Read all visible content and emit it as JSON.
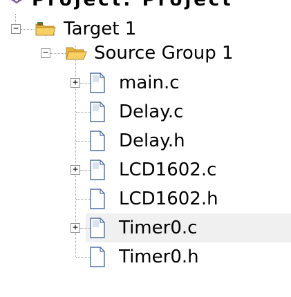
{
  "project": {
    "label": "Project: Project",
    "icon": "project-icon"
  },
  "target": {
    "label": "Target 1",
    "icon": "target-folder-icon",
    "toggle": "−"
  },
  "group": {
    "label": "Source Group 1",
    "icon": "folder-open-icon",
    "toggle": "−"
  },
  "files": [
    {
      "name": "main.c",
      "icon": "c-file-icon",
      "toggle": "+"
    },
    {
      "name": "Delay.c",
      "icon": "c-file-icon",
      "toggle": ""
    },
    {
      "name": "Delay.h",
      "icon": "h-file-icon",
      "toggle": ""
    },
    {
      "name": "LCD1602.c",
      "icon": "c-file-icon",
      "toggle": "+"
    },
    {
      "name": "LCD1602.h",
      "icon": "h-file-icon",
      "toggle": ""
    },
    {
      "name": "Timer0.c",
      "icon": "c-file-icon",
      "toggle": "+"
    },
    {
      "name": "Timer0.h",
      "icon": "h-file-icon",
      "toggle": ""
    }
  ],
  "colors": {
    "selection": "#f0f0f0",
    "folder": "#f5c244",
    "file_border": "#4a6fa5",
    "toggle_border": "#919191"
  }
}
